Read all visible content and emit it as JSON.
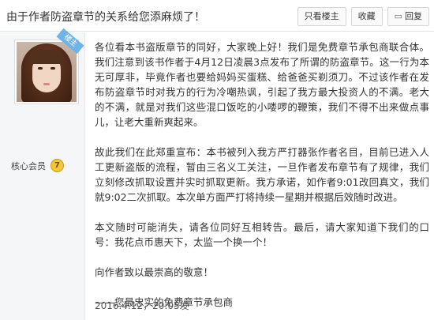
{
  "post": {
    "title": "由于作者防盗章节的关系给您添麻烦了！",
    "buttons": {
      "author_only": "只看楼主",
      "favorite": "收藏",
      "reply": "回复"
    }
  },
  "author": {
    "ribbon": "楼主",
    "member_label": "核心会员",
    "level": "7"
  },
  "body": {
    "p1": "各位看本书盗版章节的同好，大家晚上好！我们是免费章节承包商联合体。我们注意到该书作者于4月12日凌晨3点发布了所谓的防盗章节。这一行为本无可厚非，毕竟作者也要给妈妈买蛋糕、给爸爸买剃须刀。不过该作者在发布防盗章节时对我方的行为冷嘲热讽，引起了我方最大投资人的不满。老大的不满，就是对我们这些混口饭吃的小喽啰的鞭策，我们不得不出来做点事儿，让老大重新爽起来。",
    "p2": "故此我们在此郑重宣布：本书被列入我方严打器张作者名目，目前已进入人工更新盗版的流程，暂由三名义工关注，一旦作者发布章节有了规律，我们立刻修改抓取设置并实时抓取更新。我方承诺，如作者9:01改回真文，我们就9:02二次抓取。本次单方面严打将持续一星期并根据后效随时改进。",
    "p3": "本文随时可能消失，请各位同好互相转告。最后，请大家知道下我们的口号：我花点币惠天下，太监一个换一个！",
    "p4": "向作者致以最崇高的敬意！",
    "p5": "——您最忠实的免费章节承包商"
  },
  "meta": {
    "date": "2016.4.12，20:05发"
  }
}
